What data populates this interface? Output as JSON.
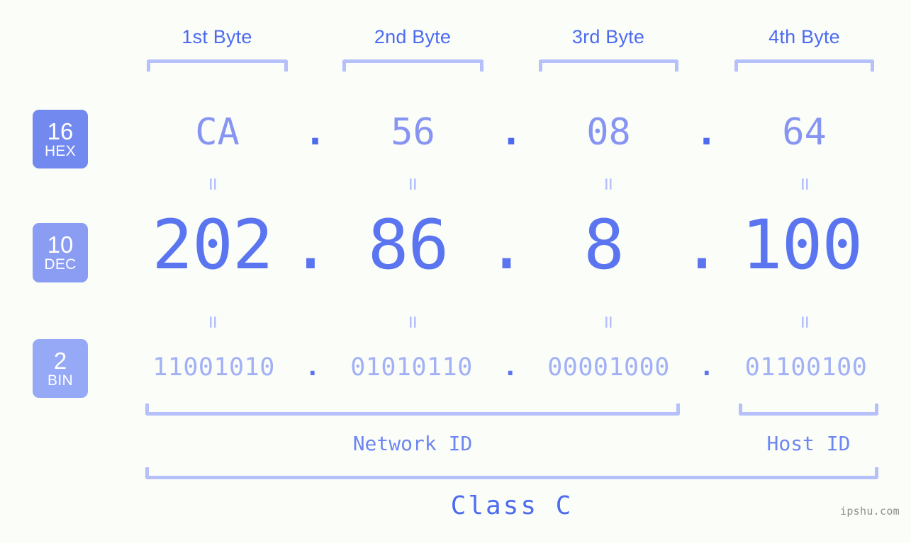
{
  "background_color": "#fbfdf9",
  "accent_colors": {
    "strong_blue": "#4c6bf0",
    "mid_blue": "#8795f2",
    "light_blue": "#a2b0f6",
    "bracket_blue": "#b6c0fb",
    "badge_hex": "#7289f0",
    "badge_dec": "#8b9cf3",
    "badge_bin": "#96a9f7",
    "watermark_gray": "#8e8e8e"
  },
  "byte_headers": [
    {
      "label": "1st Byte"
    },
    {
      "label": "2nd Byte"
    },
    {
      "label": "3rd Byte"
    },
    {
      "label": "4th Byte"
    }
  ],
  "bases": [
    {
      "number": "16",
      "name": "HEX"
    },
    {
      "number": "10",
      "name": "DEC"
    },
    {
      "number": "2",
      "name": "BIN"
    }
  ],
  "rows": {
    "hex": {
      "base_number": "16",
      "base_name": "HEX",
      "values": [
        "CA",
        "56",
        "08",
        "64"
      ],
      "separator": "."
    },
    "dec": {
      "base_number": "10",
      "base_name": "DEC",
      "values": [
        "202",
        "86",
        "8",
        "100"
      ],
      "separator": "."
    },
    "bin": {
      "base_number": "2",
      "base_name": "BIN",
      "values": [
        "11001010",
        "01010110",
        "00001000",
        "01100100"
      ],
      "separator": "."
    }
  },
  "equals_symbol": "=",
  "partitions": {
    "network_id": "Network ID",
    "host_id": "Host ID",
    "class": "Class C"
  },
  "watermark": "ipshu.com",
  "ip_address": "202.86.8.100"
}
